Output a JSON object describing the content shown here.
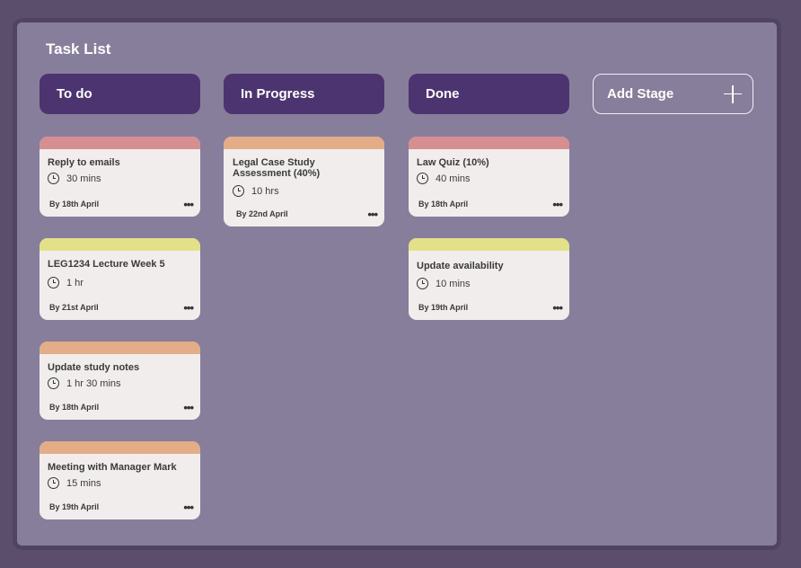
{
  "board": {
    "title": "Task List",
    "add_stage_label": "Add Stage",
    "stages": [
      {
        "label": "To do"
      },
      {
        "label": "In Progress"
      },
      {
        "label": "Done"
      }
    ]
  },
  "colors": {
    "background": "#5a4e6c",
    "panel": "#877e9b",
    "stage_header": "#4c3470",
    "card": "#f1eded",
    "tag_pink": "#d58f90",
    "tag_yellow": "#e3e08a",
    "tag_peach": "#e2ad87"
  },
  "cards": {
    "todo": [
      {
        "title": "Reply to emails",
        "duration": "30 mins",
        "due": "By 18th April",
        "tag": "pink"
      },
      {
        "title": "LEG1234 Lecture Week 5",
        "duration": "1 hr",
        "due": "By 21st April",
        "tag": "yellow"
      },
      {
        "title": "Update study notes",
        "duration": "1 hr 30 mins",
        "due": "By 18th April",
        "tag": "peach"
      },
      {
        "title": "Meeting with Manager Mark",
        "duration": "15 mins",
        "due": "By 19th April",
        "tag": "peach"
      }
    ],
    "in_progress": [
      {
        "title": "Legal Case Study Assessment (40%)",
        "duration": "10 hrs",
        "due": "By 22nd April",
        "tag": "peach"
      }
    ],
    "done": [
      {
        "title": "Law Quiz (10%)",
        "duration": "40 mins",
        "due": "By 18th April",
        "tag": "pink"
      },
      {
        "title": "Update availability",
        "duration": "10 mins",
        "due": "By 19th April",
        "tag": "yellow"
      }
    ]
  },
  "icons": {
    "duration": "clock-icon",
    "card_menu": "more-icon",
    "add": "plus-icon"
  },
  "card_menu_glyph": "•••"
}
